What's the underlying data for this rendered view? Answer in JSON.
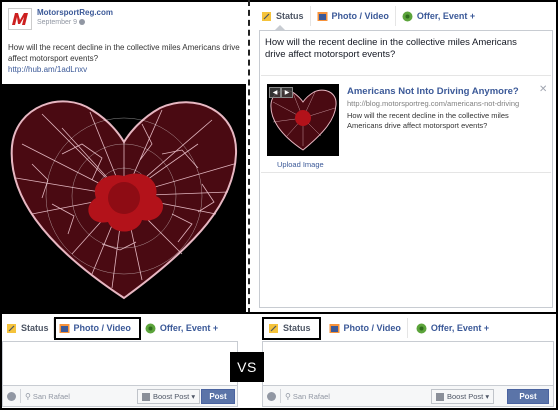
{
  "post": {
    "page_name": "MotorsportReg.com",
    "date": "September 9",
    "text": "How will the recent decline in the collective miles Americans drive affect motorsport events?",
    "link": "http://hub.am/1adLnxv",
    "image_alt": "broken heart"
  },
  "composer_top": {
    "tabs": [
      {
        "label": "Status",
        "icon": "status-icon"
      },
      {
        "label": "Photo / Video",
        "icon": "camera-icon"
      },
      {
        "label": "Offer, Event +",
        "icon": "offer-icon"
      }
    ],
    "text": "How will the recent decline in the collective miles Americans drive affect motorsport events?",
    "preview": {
      "title": "Americans Not Into Driving Anymore?",
      "url": "http://blog.motorsportreg.com/americans-not-driving",
      "description": "How will the recent decline in the collective miles Americans drive affect motorsport events?",
      "upload_label": "Upload Image",
      "prev_arrow": "◀",
      "next_arrow": "▶",
      "close": "✕"
    }
  },
  "composer_bottom_left": {
    "tabs": [
      {
        "label": "Status"
      },
      {
        "label": "Photo / Video"
      },
      {
        "label": "Offer, Event +"
      }
    ],
    "location": "San Rafael",
    "boost": "Boost Post ▾",
    "post_button": "Post"
  },
  "composer_bottom_right": {
    "tabs": [
      {
        "label": "Status"
      },
      {
        "label": "Photo / Video"
      },
      {
        "label": "Offer, Event +"
      }
    ],
    "location": "San Rafael",
    "boost": "Boost Post ▾",
    "post_button": "Post"
  },
  "vs_label": "VS",
  "colors": {
    "link_blue": "#3b5998",
    "heart_red": "#b3121a",
    "post_button": "#5b74a8"
  }
}
